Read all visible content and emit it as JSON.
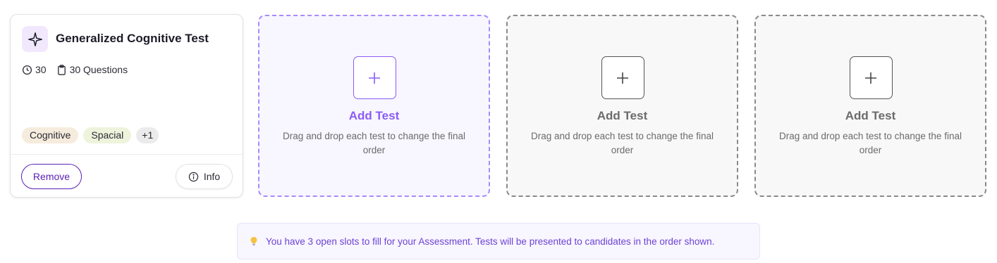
{
  "test_card": {
    "title": "Generalized Cognitive Test",
    "icon": "sparkle-icon",
    "duration": "30",
    "questions": "30 Questions",
    "tags": [
      "Cognitive",
      "Spacial",
      "+1"
    ],
    "remove_label": "Remove",
    "info_label": "Info"
  },
  "slots": [
    {
      "title": "Add Test",
      "description": "Drag and drop each test to change the final order"
    },
    {
      "title": "Add Test",
      "description": "Drag and drop each test to change the final order"
    },
    {
      "title": "Add Test",
      "description": "Drag and drop each test to change the final order"
    }
  ],
  "banner": {
    "text": "You have 3 open slots to fill for your Assessment. Tests will be presented to candidates in the order shown."
  },
  "colors": {
    "accent": "#8b5cf6",
    "accent_dark": "#5b21b6",
    "tag_cognitive": "#f6ecdd",
    "tag_spacial": "#eef3dc"
  }
}
